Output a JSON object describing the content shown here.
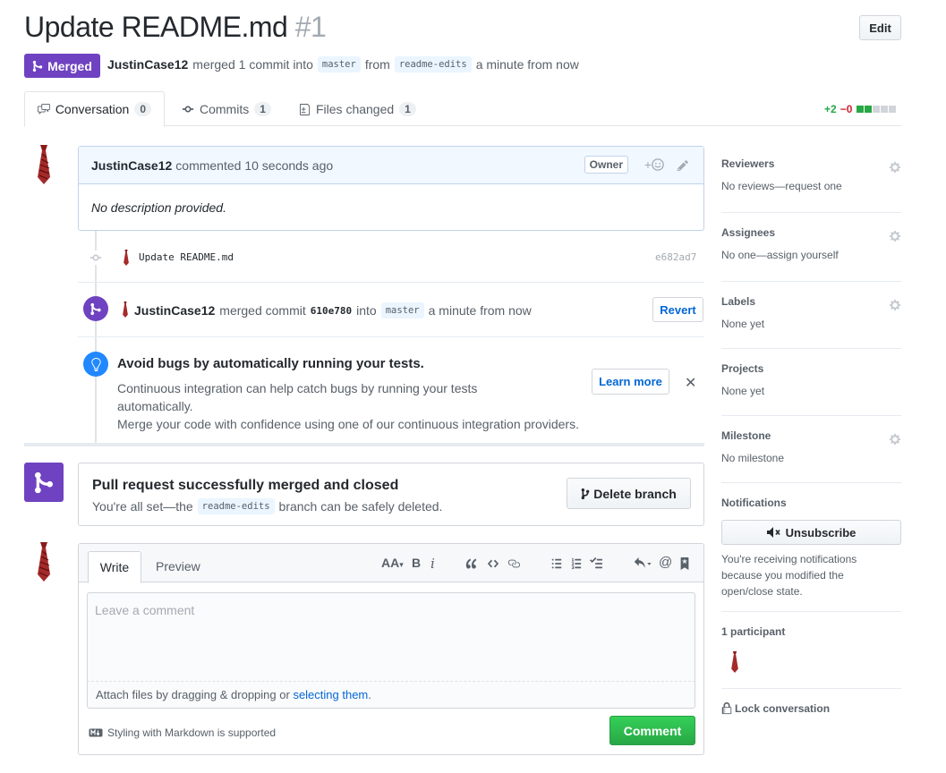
{
  "pr": {
    "title": "Update README.md",
    "number": "#1",
    "edit_label": "Edit",
    "state": "Merged",
    "author": "JustinCase12",
    "merged_text": "merged 1 commit into",
    "base_branch": "master",
    "from_text": "from",
    "head_branch": "readme-edits",
    "time_text": "a minute from now"
  },
  "tabs": [
    {
      "label": "Conversation",
      "count": "0"
    },
    {
      "label": "Commits",
      "count": "1"
    },
    {
      "label": "Files changed",
      "count": "1"
    }
  ],
  "diffstat": {
    "additions": "+2",
    "deletions": "−0"
  },
  "comment": {
    "author": "JustinCase12",
    "action": "commented 10 seconds ago",
    "badge": "Owner",
    "body": "No description provided."
  },
  "commit": {
    "message": "Update README.md",
    "sha": "e682ad7"
  },
  "merge_event": {
    "author": "JustinCase12",
    "action": "merged commit",
    "sha": "610e780",
    "into_text": "into",
    "branch": "master",
    "time_text": "a minute from now",
    "revert_label": "Revert"
  },
  "ci": {
    "title": "Avoid bugs by automatically running your tests.",
    "line1": "Continuous integration can help catch bugs by running your tests",
    "line2": "automatically.",
    "line3": "Merge your code with confidence using one of our continuous integration providers.",
    "learn_label": "Learn more",
    "close_glyph": "✕"
  },
  "merged": {
    "title": "Pull request successfully merged and closed",
    "prefix": "You're all set—the",
    "branch": "readme-edits",
    "suffix": "branch can be safely deleted.",
    "delete_label": "Delete branch"
  },
  "editor": {
    "write_tab": "Write",
    "preview_tab": "Preview",
    "placeholder": "Leave a comment",
    "attach_prefix": "Attach files by dragging & dropping or",
    "attach_link": "selecting them",
    "attach_suffix": ".",
    "markdown_note": "Styling with Markdown is supported",
    "comment_label": "Comment",
    "toolbar": {
      "header": "AA",
      "bold": "B",
      "italic": "i",
      "mention": "@"
    }
  },
  "sidebar": {
    "reviewers": {
      "heading": "Reviewers",
      "value": "No reviews—request one"
    },
    "assignees": {
      "heading": "Assignees",
      "value": "No one—assign yourself"
    },
    "labels": {
      "heading": "Labels",
      "value": "None yet"
    },
    "projects": {
      "heading": "Projects",
      "value": "None yet"
    },
    "milestone": {
      "heading": "Milestone",
      "value": "No milestone"
    },
    "notifications": {
      "heading": "Notifications",
      "button": "Unsubscribe",
      "line1": "You're receiving notifications",
      "line2": "because you modified the",
      "line3": "open/close state."
    },
    "participants": {
      "heading": "1 participant"
    },
    "lock": "Lock conversation"
  },
  "colors": {
    "merged_purple": "#6f42c1",
    "green": "#28a745",
    "red": "#cb2431",
    "link": "#0366d6"
  },
  "icons": [
    "merge-icon",
    "comment-icon",
    "commit-icon",
    "file-diff-icon",
    "gear-icon",
    "smiley-icon",
    "pencil-icon",
    "lightbulb-icon",
    "branch-icon",
    "mute-icon",
    "lock-icon",
    "markdown-icon",
    "tie-avatar"
  ]
}
